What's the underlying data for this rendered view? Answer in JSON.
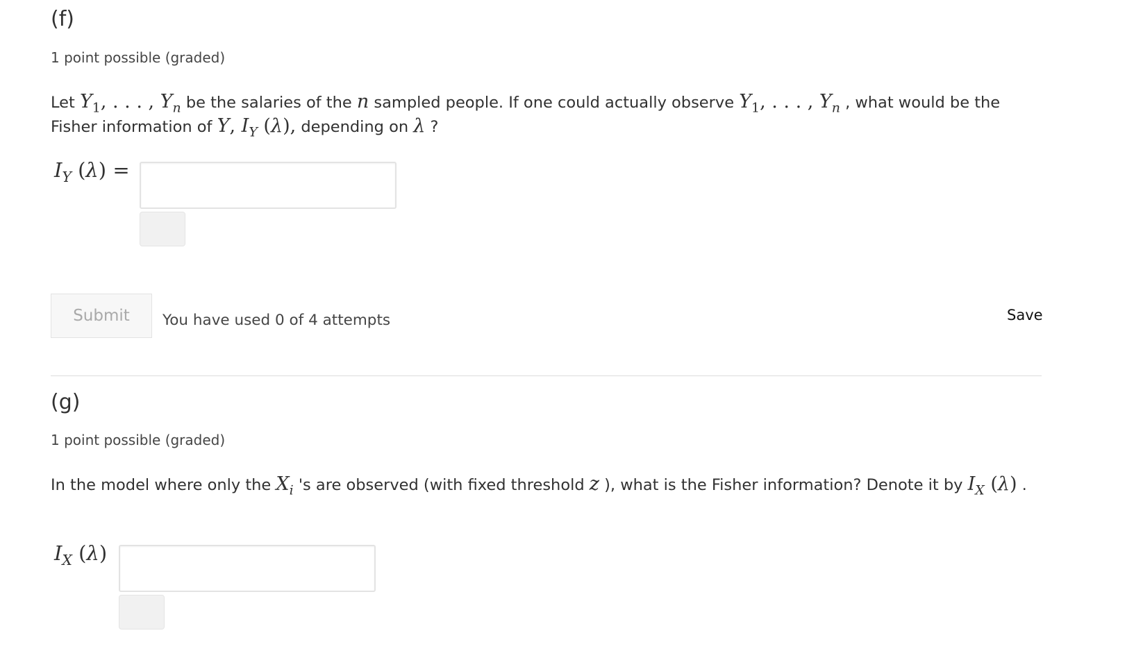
{
  "problem_f": {
    "title": "(f)",
    "meta": "1 point possible (graded)",
    "stem": {
      "t1": "Let ",
      "t2": " be the salaries of the ",
      "t3": " sampled people. If one could actually observe ",
      "t4": " , what would be the Fisher information of ",
      "t5": " depending on ",
      "t6": " ?"
    },
    "answer_value": "",
    "submit_label": "Submit",
    "attempts_text": "You have used 0 of 4 attempts",
    "save_label": "Save"
  },
  "problem_g": {
    "title": "(g)",
    "meta": "1 point possible (graded)",
    "stem": {
      "t1": "In the model where only the ",
      "t2": " 's are observed (with fixed threshold ",
      "t3": " ), what is the Fisher information? Denote it by ",
      "t4": " ."
    },
    "answer_value": ""
  }
}
